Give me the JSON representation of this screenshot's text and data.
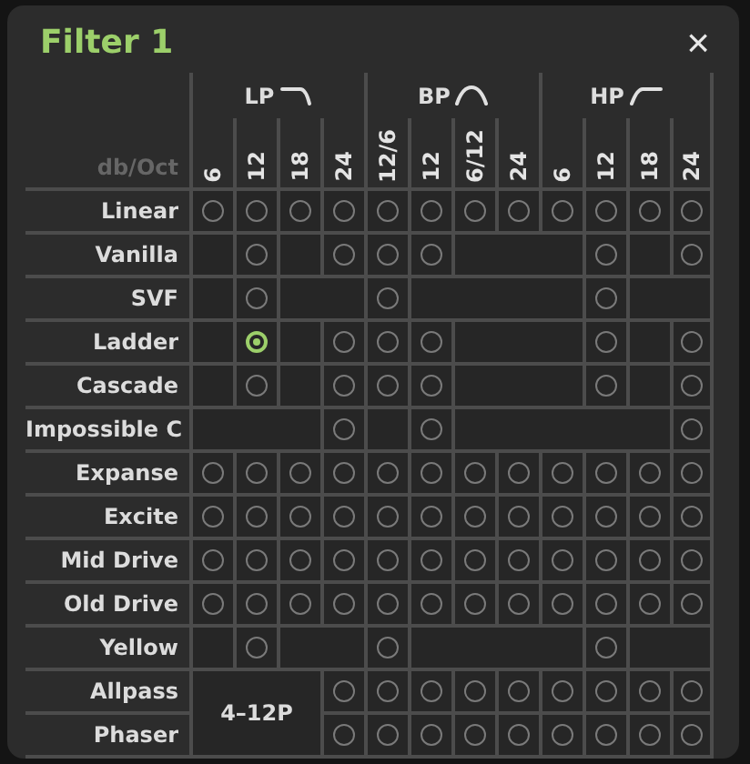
{
  "window": {
    "title": "Filter 1",
    "close": "×"
  },
  "header": {
    "unit_label": "db/Oct",
    "groups": [
      {
        "label": "LP",
        "kind": "lowpass"
      },
      {
        "label": "BP",
        "kind": "bandpass"
      },
      {
        "label": "HP",
        "kind": "highpass"
      }
    ],
    "columns": [
      "6",
      "12",
      "18",
      "24",
      "12/6",
      "12",
      "6/12",
      "24",
      "6",
      "12",
      "18",
      "24"
    ]
  },
  "shared_label": "4–12P",
  "rows": [
    {
      "name": "Linear",
      "cells": [
        {
          "kind": "radio",
          "selected": false
        },
        {
          "kind": "radio",
          "selected": false
        },
        {
          "kind": "radio",
          "selected": false
        },
        {
          "kind": "radio",
          "selected": false
        },
        {
          "kind": "radio",
          "selected": false
        },
        {
          "kind": "radio",
          "selected": false
        },
        {
          "kind": "radio",
          "selected": false
        },
        {
          "kind": "radio",
          "selected": false
        },
        {
          "kind": "radio",
          "selected": false
        },
        {
          "kind": "radio",
          "selected": false
        },
        {
          "kind": "radio",
          "selected": false
        },
        {
          "kind": "radio",
          "selected": false
        }
      ]
    },
    {
      "name": "Vanilla",
      "cells": [
        {
          "kind": "blank"
        },
        {
          "kind": "radio",
          "selected": false
        },
        {
          "kind": "blank"
        },
        {
          "kind": "radio",
          "selected": false
        },
        {
          "kind": "radio",
          "selected": false
        },
        {
          "kind": "radio",
          "selected": false
        },
        {
          "kind": "blank"
        },
        {
          "kind": "blank"
        },
        {
          "kind": "blank"
        },
        {
          "kind": "radio",
          "selected": false
        },
        {
          "kind": "blank"
        },
        {
          "kind": "radio",
          "selected": false
        }
      ]
    },
    {
      "name": "SVF",
      "cells": [
        {
          "kind": "blank"
        },
        {
          "kind": "radio",
          "selected": false
        },
        {
          "kind": "blank"
        },
        {
          "kind": "blank"
        },
        {
          "kind": "radio",
          "selected": false
        },
        {
          "kind": "blank"
        },
        {
          "kind": "blank"
        },
        {
          "kind": "blank"
        },
        {
          "kind": "blank"
        },
        {
          "kind": "radio",
          "selected": false
        },
        {
          "kind": "blank"
        },
        {
          "kind": "blank"
        }
      ]
    },
    {
      "name": "Ladder",
      "cells": [
        {
          "kind": "blank"
        },
        {
          "kind": "radio",
          "selected": true
        },
        {
          "kind": "blank"
        },
        {
          "kind": "radio",
          "selected": false
        },
        {
          "kind": "radio",
          "selected": false
        },
        {
          "kind": "radio",
          "selected": false
        },
        {
          "kind": "blank"
        },
        {
          "kind": "blank"
        },
        {
          "kind": "blank"
        },
        {
          "kind": "radio",
          "selected": false
        },
        {
          "kind": "blank"
        },
        {
          "kind": "radio",
          "selected": false
        }
      ]
    },
    {
      "name": "Cascade",
      "cells": [
        {
          "kind": "blank"
        },
        {
          "kind": "radio",
          "selected": false
        },
        {
          "kind": "blank"
        },
        {
          "kind": "radio",
          "selected": false
        },
        {
          "kind": "radio",
          "selected": false
        },
        {
          "kind": "radio",
          "selected": false
        },
        {
          "kind": "blank"
        },
        {
          "kind": "blank"
        },
        {
          "kind": "blank"
        },
        {
          "kind": "radio",
          "selected": false
        },
        {
          "kind": "blank"
        },
        {
          "kind": "radio",
          "selected": false
        }
      ]
    },
    {
      "name": "Impossible C",
      "cells": [
        {
          "kind": "blank"
        },
        {
          "kind": "blank"
        },
        {
          "kind": "blank"
        },
        {
          "kind": "radio",
          "selected": false
        },
        {
          "kind": "blank"
        },
        {
          "kind": "radio",
          "selected": false
        },
        {
          "kind": "blank"
        },
        {
          "kind": "blank"
        },
        {
          "kind": "blank"
        },
        {
          "kind": "blank"
        },
        {
          "kind": "blank"
        },
        {
          "kind": "radio",
          "selected": false
        }
      ]
    },
    {
      "name": "Expanse",
      "cells": [
        {
          "kind": "radio",
          "selected": false
        },
        {
          "kind": "radio",
          "selected": false
        },
        {
          "kind": "radio",
          "selected": false
        },
        {
          "kind": "radio",
          "selected": false
        },
        {
          "kind": "radio",
          "selected": false
        },
        {
          "kind": "radio",
          "selected": false
        },
        {
          "kind": "radio",
          "selected": false
        },
        {
          "kind": "radio",
          "selected": false
        },
        {
          "kind": "radio",
          "selected": false
        },
        {
          "kind": "radio",
          "selected": false
        },
        {
          "kind": "radio",
          "selected": false
        },
        {
          "kind": "radio",
          "selected": false
        }
      ]
    },
    {
      "name": "Excite",
      "cells": [
        {
          "kind": "radio",
          "selected": false
        },
        {
          "kind": "radio",
          "selected": false
        },
        {
          "kind": "radio",
          "selected": false
        },
        {
          "kind": "radio",
          "selected": false
        },
        {
          "kind": "radio",
          "selected": false
        },
        {
          "kind": "radio",
          "selected": false
        },
        {
          "kind": "radio",
          "selected": false
        },
        {
          "kind": "radio",
          "selected": false
        },
        {
          "kind": "radio",
          "selected": false
        },
        {
          "kind": "radio",
          "selected": false
        },
        {
          "kind": "radio",
          "selected": false
        },
        {
          "kind": "radio",
          "selected": false
        }
      ]
    },
    {
      "name": "Mid Drive",
      "cells": [
        {
          "kind": "radio",
          "selected": false
        },
        {
          "kind": "radio",
          "selected": false
        },
        {
          "kind": "radio",
          "selected": false
        },
        {
          "kind": "radio",
          "selected": false
        },
        {
          "kind": "radio",
          "selected": false
        },
        {
          "kind": "radio",
          "selected": false
        },
        {
          "kind": "radio",
          "selected": false
        },
        {
          "kind": "radio",
          "selected": false
        },
        {
          "kind": "radio",
          "selected": false
        },
        {
          "kind": "radio",
          "selected": false
        },
        {
          "kind": "radio",
          "selected": false
        },
        {
          "kind": "radio",
          "selected": false
        }
      ]
    },
    {
      "name": "Old Drive",
      "cells": [
        {
          "kind": "radio",
          "selected": false
        },
        {
          "kind": "radio",
          "selected": false
        },
        {
          "kind": "radio",
          "selected": false
        },
        {
          "kind": "radio",
          "selected": false
        },
        {
          "kind": "radio",
          "selected": false
        },
        {
          "kind": "radio",
          "selected": false
        },
        {
          "kind": "radio",
          "selected": false
        },
        {
          "kind": "radio",
          "selected": false
        },
        {
          "kind": "radio",
          "selected": false
        },
        {
          "kind": "radio",
          "selected": false
        },
        {
          "kind": "radio",
          "selected": false
        },
        {
          "kind": "radio",
          "selected": false
        }
      ]
    },
    {
      "name": "Yellow",
      "cells": [
        {
          "kind": "blank"
        },
        {
          "kind": "radio",
          "selected": false
        },
        {
          "kind": "blank"
        },
        {
          "kind": "blank"
        },
        {
          "kind": "radio",
          "selected": false
        },
        {
          "kind": "blank"
        },
        {
          "kind": "blank"
        },
        {
          "kind": "blank"
        },
        {
          "kind": "blank"
        },
        {
          "kind": "radio",
          "selected": false
        },
        {
          "kind": "blank"
        },
        {
          "kind": "blank"
        }
      ]
    },
    {
      "name": "Allpass",
      "cells": [
        {
          "kind": "shared"
        },
        {
          "kind": "shared"
        },
        {
          "kind": "shared"
        },
        {
          "kind": "radio",
          "selected": false
        },
        {
          "kind": "radio",
          "selected": false
        },
        {
          "kind": "radio",
          "selected": false
        },
        {
          "kind": "radio",
          "selected": false
        },
        {
          "kind": "radio",
          "selected": false
        },
        {
          "kind": "radio",
          "selected": false
        },
        {
          "kind": "radio",
          "selected": false
        },
        {
          "kind": "radio",
          "selected": false
        },
        {
          "kind": "radio",
          "selected": false
        }
      ]
    },
    {
      "name": "Phaser",
      "cells": [
        {
          "kind": "shared"
        },
        {
          "kind": "shared"
        },
        {
          "kind": "shared"
        },
        {
          "kind": "radio",
          "selected": false
        },
        {
          "kind": "radio",
          "selected": false
        },
        {
          "kind": "radio",
          "selected": false
        },
        {
          "kind": "radio",
          "selected": false
        },
        {
          "kind": "radio",
          "selected": false
        },
        {
          "kind": "radio",
          "selected": false
        },
        {
          "kind": "radio",
          "selected": false
        },
        {
          "kind": "radio",
          "selected": false
        },
        {
          "kind": "radio",
          "selected": false
        }
      ]
    }
  ]
}
